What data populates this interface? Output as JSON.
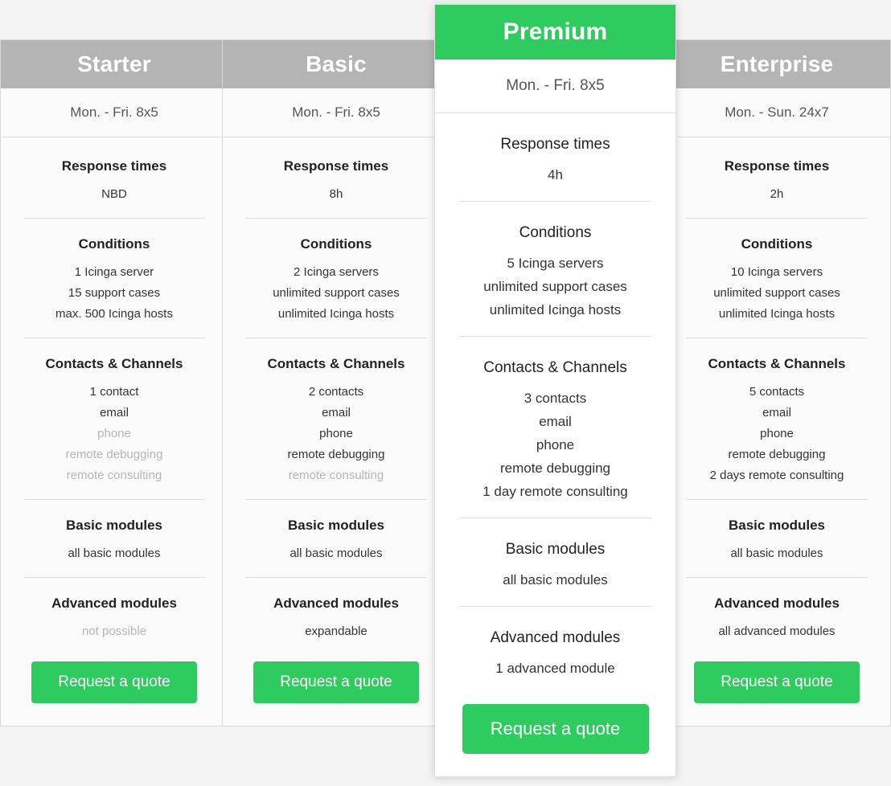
{
  "colors": {
    "accent_green": "#2ecc5e",
    "header_gray": "#b4b4b4",
    "page_background": "#f4f4f4",
    "card_background": "#fbfbfb",
    "featured_card_background": "#ffffff",
    "text": "#333333",
    "text_dim": "#b5b5b5"
  },
  "plans": [
    {
      "name": "Starter",
      "featured": false,
      "hours": "Mon. - Fri. 8x5",
      "sections": [
        {
          "title": "Response times",
          "lines": [
            {
              "text": "NBD",
              "dim": false
            }
          ]
        },
        {
          "title": "Conditions",
          "lines": [
            {
              "text": "1 Icinga server",
              "dim": false
            },
            {
              "text": "15 support cases",
              "dim": false
            },
            {
              "text": "max. 500 Icinga hosts",
              "dim": false
            }
          ]
        },
        {
          "title": "Contacts & Channels",
          "lines": [
            {
              "text": "1 contact",
              "dim": false
            },
            {
              "text": "email",
              "dim": false
            },
            {
              "text": "phone",
              "dim": true
            },
            {
              "text": "remote debugging",
              "dim": true
            },
            {
              "text": "remote consulting",
              "dim": true
            }
          ]
        },
        {
          "title": "Basic modules",
          "lines": [
            {
              "text": "all basic modules",
              "dim": false
            }
          ]
        },
        {
          "title": "Advanced modules",
          "lines": [
            {
              "text": "not possible",
              "dim": true
            }
          ]
        }
      ],
      "cta_label": "Request a quote"
    },
    {
      "name": "Basic",
      "featured": false,
      "hours": "Mon. - Fri. 8x5",
      "sections": [
        {
          "title": "Response times",
          "lines": [
            {
              "text": "8h",
              "dim": false
            }
          ]
        },
        {
          "title": "Conditions",
          "lines": [
            {
              "text": "2 Icinga servers",
              "dim": false
            },
            {
              "text": "unlimited support cases",
              "dim": false
            },
            {
              "text": "unlimited Icinga hosts",
              "dim": false
            }
          ]
        },
        {
          "title": "Contacts & Channels",
          "lines": [
            {
              "text": "2 contacts",
              "dim": false
            },
            {
              "text": "email",
              "dim": false
            },
            {
              "text": "phone",
              "dim": false
            },
            {
              "text": "remote debugging",
              "dim": false
            },
            {
              "text": "remote consulting",
              "dim": true
            }
          ]
        },
        {
          "title": "Basic modules",
          "lines": [
            {
              "text": "all basic modules",
              "dim": false
            }
          ]
        },
        {
          "title": "Advanced modules",
          "lines": [
            {
              "text": "expandable",
              "dim": false
            }
          ]
        }
      ],
      "cta_label": "Request a quote"
    },
    {
      "name": "Premium",
      "featured": true,
      "hours": "Mon. - Fri. 8x5",
      "sections": [
        {
          "title": "Response times",
          "lines": [
            {
              "text": "4h",
              "dim": false
            }
          ]
        },
        {
          "title": "Conditions",
          "lines": [
            {
              "text": "5 Icinga servers",
              "dim": false
            },
            {
              "text": "unlimited support cases",
              "dim": false
            },
            {
              "text": "unlimited Icinga hosts",
              "dim": false
            }
          ]
        },
        {
          "title": "Contacts & Channels",
          "lines": [
            {
              "text": "3 contacts",
              "dim": false
            },
            {
              "text": "email",
              "dim": false
            },
            {
              "text": "phone",
              "dim": false
            },
            {
              "text": "remote debugging",
              "dim": false
            },
            {
              "text": "1 day remote consulting",
              "dim": false
            }
          ]
        },
        {
          "title": "Basic modules",
          "lines": [
            {
              "text": "all basic modules",
              "dim": false
            }
          ]
        },
        {
          "title": "Advanced modules",
          "lines": [
            {
              "text": "1 advanced module",
              "dim": false
            }
          ]
        }
      ],
      "cta_label": "Request a quote"
    },
    {
      "name": "Enterprise",
      "featured": false,
      "hours": "Mon. - Sun. 24x7",
      "sections": [
        {
          "title": "Response times",
          "lines": [
            {
              "text": "2h",
              "dim": false
            }
          ]
        },
        {
          "title": "Conditions",
          "lines": [
            {
              "text": "10 Icinga servers",
              "dim": false
            },
            {
              "text": "unlimited support cases",
              "dim": false
            },
            {
              "text": "unlimited Icinga hosts",
              "dim": false
            }
          ]
        },
        {
          "title": "Contacts & Channels",
          "lines": [
            {
              "text": "5 contacts",
              "dim": false
            },
            {
              "text": "email",
              "dim": false
            },
            {
              "text": "phone",
              "dim": false
            },
            {
              "text": "remote debugging",
              "dim": false
            },
            {
              "text": "2 days remote consulting",
              "dim": false
            }
          ]
        },
        {
          "title": "Basic modules",
          "lines": [
            {
              "text": "all basic modules",
              "dim": false
            }
          ]
        },
        {
          "title": "Advanced modules",
          "lines": [
            {
              "text": "all advanced modules",
              "dim": false
            }
          ]
        }
      ],
      "cta_label": "Request a quote"
    }
  ]
}
